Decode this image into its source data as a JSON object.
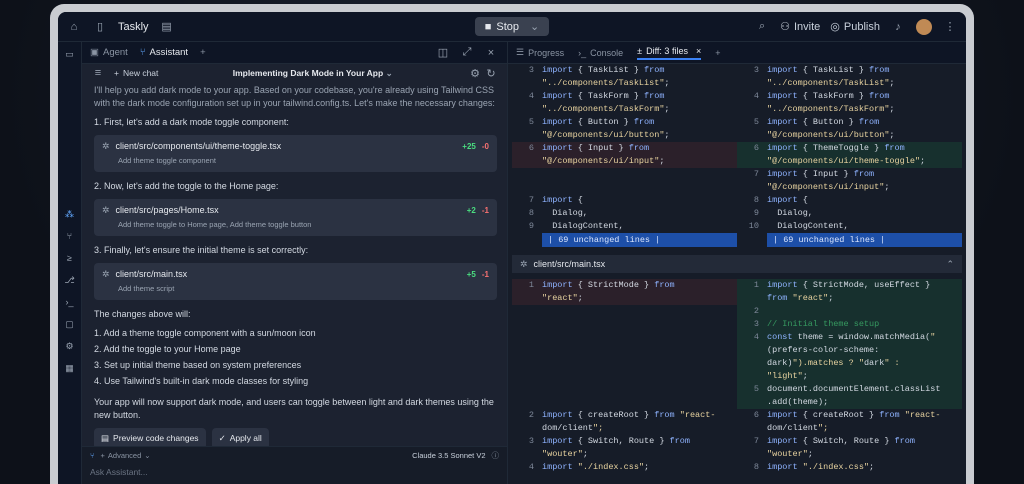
{
  "topbar": {
    "app_name": "Taskly",
    "stop_label": "Stop",
    "invite_label": "Invite",
    "publish_label": "Publish"
  },
  "left": {
    "tabs": [
      "Agent",
      "Assistant"
    ],
    "new_chat": "New chat",
    "chat_title": "Implementing Dark Mode in Your App",
    "intro": "I'll help you add dark mode to your app. Based on your codebase, you're already using Tailwind CSS with the dark mode configuration set up in your tailwind.config.ts. Let's make the necessary changes:",
    "step1": "1. First, let's add a dark mode toggle component:",
    "file1": {
      "path": "client/src/components/ui/theme-toggle.tsx",
      "desc": "Add theme toggle component",
      "plus": "+25",
      "minus": "-0"
    },
    "step2": "2. Now, let's add the toggle to the Home page:",
    "file2": {
      "path": "client/src/pages/Home.tsx",
      "desc": "Add theme toggle to Home page, Add theme toggle button",
      "plus": "+2",
      "minus": "-1"
    },
    "step3": "3. Finally, let's ensure the initial theme is set correctly:",
    "file3": {
      "path": "client/src/main.tsx",
      "desc": "Add theme script",
      "plus": "+5",
      "minus": "-1"
    },
    "changes_intro": "The changes above will:",
    "changes": [
      "1. Add a theme toggle component with a sun/moon icon",
      "2. Add the toggle to your Home page",
      "3. Set up initial theme based on system preferences",
      "4. Use Tailwind's built-in dark mode classes for styling"
    ],
    "outro": "Your app will now support dark mode, and users can toggle between light and dark themes using the new button.",
    "preview_btn": "Preview code changes",
    "apply_btn": "Apply all",
    "advanced": "Advanced",
    "model": "Claude 3.5 Sonnet V2",
    "input_placeholder": "Ask Assistant..."
  },
  "right": {
    "tabs": [
      "Progress",
      "Console",
      "Diff: 3 files"
    ],
    "unchanged": "| 69 unchanged lines |",
    "file2_name": "client/src/main.tsx"
  },
  "diff1": {
    "left": [
      {
        "n": "3",
        "c": "import { TaskList } from"
      },
      {
        "n": "",
        "c": "\"../components/TaskList\";"
      },
      {
        "n": "4",
        "c": "import { TaskForm } from"
      },
      {
        "n": "",
        "c": "\"../components/TaskForm\";"
      },
      {
        "n": "5",
        "c": "import { Button } from"
      },
      {
        "n": "",
        "c": "\"@/components/ui/button\";"
      },
      {
        "n": "6",
        "c": "import { Input } from"
      },
      {
        "n": "",
        "c": "\"@/components/ui/input\";"
      }
    ],
    "right": [
      {
        "n": "3",
        "c": "import { TaskList } from"
      },
      {
        "n": "",
        "c": "\"../components/TaskList\";"
      },
      {
        "n": "4",
        "c": "import { TaskForm } from"
      },
      {
        "n": "",
        "c": "\"../components/TaskForm\";"
      },
      {
        "n": "5",
        "c": "import { Button } from"
      },
      {
        "n": "",
        "c": "\"@/components/ui/button\";"
      },
      {
        "n": "6",
        "c": "import { ThemeToggle } from"
      },
      {
        "n": "",
        "c": "\"@/components/ui/theme-toggle\";"
      },
      {
        "n": "7",
        "c": "import { Input } from"
      },
      {
        "n": "",
        "c": "\"@/components/ui/input\";"
      },
      {
        "n": "8",
        "c": "import {"
      },
      {
        "n": "9",
        "c": "  Dialog,"
      },
      {
        "n": "10",
        "c": "  DialogContent,"
      }
    ],
    "left_tail": [
      {
        "n": "7",
        "c": "import {"
      },
      {
        "n": "8",
        "c": "  Dialog,"
      },
      {
        "n": "9",
        "c": "  DialogContent,"
      }
    ]
  },
  "diff2": {
    "left": [
      {
        "n": "1",
        "c": "import { StrictMode } from"
      },
      {
        "n": "",
        "c": "\"react\";"
      }
    ],
    "right": [
      {
        "n": "1",
        "c": "import { StrictMode, useEffect }"
      },
      {
        "n": "",
        "c": "from \"react\";"
      },
      {
        "n": "2",
        "c": ""
      },
      {
        "n": "3",
        "c": "// Initial theme setup"
      },
      {
        "n": "4",
        "c": "const theme = window.matchMedia(\""
      },
      {
        "n": "",
        "c": "(prefers-color-scheme:"
      },
      {
        "n": "",
        "c": "dark)\").matches ? \"dark\" :"
      },
      {
        "n": "",
        "c": "\"light\";"
      },
      {
        "n": "5",
        "c": "document.documentElement.classList"
      },
      {
        "n": "",
        "c": ".add(theme);"
      }
    ],
    "left_tail": [
      {
        "n": "2",
        "c": "import { createRoot } from \"react-"
      },
      {
        "n": "",
        "c": "dom/client\";"
      },
      {
        "n": "3",
        "c": "import { Switch, Route } from"
      },
      {
        "n": "",
        "c": "\"wouter\";"
      },
      {
        "n": "4",
        "c": "import \"./index.css\";"
      }
    ],
    "right_tail": [
      {
        "n": "6",
        "c": "import { createRoot } from \"react-"
      },
      {
        "n": "",
        "c": "dom/client\";"
      },
      {
        "n": "7",
        "c": "import { Switch, Route } from"
      },
      {
        "n": "",
        "c": "\"wouter\";"
      },
      {
        "n": "8",
        "c": "import \"./index.css\";"
      }
    ]
  }
}
